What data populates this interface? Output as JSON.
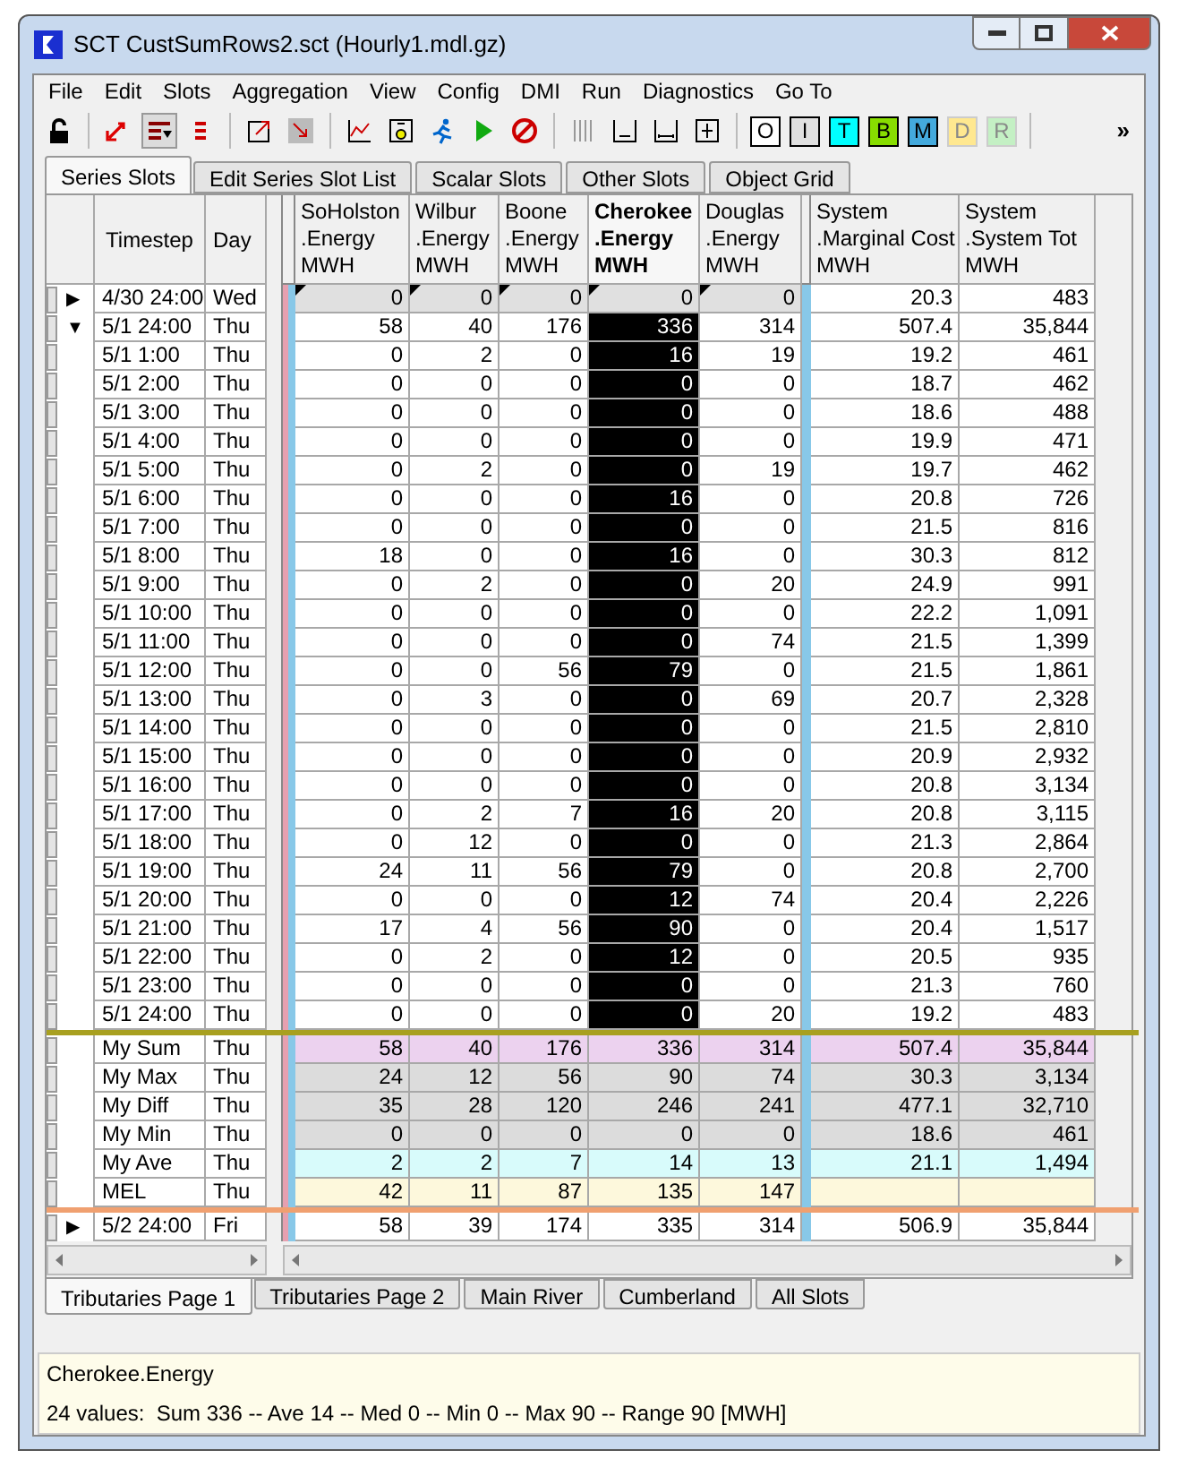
{
  "window": {
    "title": "SCT CustSumRows2.sct (Hourly1.mdl.gz)"
  },
  "menu": [
    "File",
    "Edit",
    "Slots",
    "Aggregation",
    "View",
    "Config",
    "DMI",
    "Run",
    "Diagnostics",
    "Go To"
  ],
  "toolbar": {
    "letter_buttons": [
      {
        "label": "O",
        "color": "#ffffff",
        "disabled": false
      },
      {
        "label": "I",
        "color": "#e0e0e0",
        "disabled": false
      },
      {
        "label": "T",
        "color": "#00ffff",
        "disabled": false
      },
      {
        "label": "B",
        "color": "#88dd00",
        "disabled": false
      },
      {
        "label": "M",
        "color": "#44aadd",
        "disabled": false
      },
      {
        "label": "D",
        "color": "#ffe890",
        "disabled": true
      },
      {
        "label": "R",
        "color": "#c4f0c4",
        "disabled": true
      }
    ],
    "overflow": "»"
  },
  "tabs": [
    {
      "label": "Series Slots",
      "selected": true
    },
    {
      "label": "Edit Series Slot List",
      "selected": false
    },
    {
      "label": "Scalar Slots",
      "selected": false
    },
    {
      "label": "Other Slots",
      "selected": false
    },
    {
      "label": "Object Grid",
      "selected": false
    }
  ],
  "table": {
    "row_headers": [
      "Timestep",
      "Day"
    ],
    "column_groups": [
      {
        "columns": [
          {
            "lines": [
              "SoHolston",
              ".Energy",
              "MWH"
            ],
            "selected": false
          },
          {
            "lines": [
              "Wilbur",
              ".Energy",
              "MWH"
            ],
            "selected": false
          },
          {
            "lines": [
              "Boone",
              ".Energy",
              "MWH"
            ],
            "selected": false
          },
          {
            "lines": [
              "Cherokee",
              ".Energy",
              "MWH"
            ],
            "selected": true
          },
          {
            "lines": [
              "Douglas",
              ".Energy",
              "MWH"
            ],
            "selected": false
          }
        ]
      },
      {
        "columns": [
          {
            "lines": [
              "System",
              ".Marginal Cost",
              "MWH"
            ],
            "selected": false
          },
          {
            "lines": [
              "System",
              ".System Tot",
              "MWH"
            ],
            "selected": false
          }
        ]
      }
    ],
    "rows": [
      {
        "kind": "initial",
        "marker": "▶",
        "timestep": "4/30 24:00",
        "day": "Wed",
        "values": [
          [
            "0",
            "0",
            "0",
            "0",
            "0"
          ],
          [
            "20.3",
            "483"
          ]
        ]
      },
      {
        "kind": "parent",
        "marker": "▼",
        "timestep": "5/1 24:00",
        "day": "Thu",
        "values": [
          [
            "58",
            "40",
            "176",
            "336",
            "314"
          ],
          [
            "507.4",
            "35,844"
          ]
        ]
      },
      {
        "kind": "child",
        "timestep": "5/1 1:00",
        "day": "Thu",
        "values": [
          [
            "0",
            "2",
            "0",
            "16",
            "19"
          ],
          [
            "19.2",
            "461"
          ]
        ]
      },
      {
        "kind": "child",
        "timestep": "5/1 2:00",
        "day": "Thu",
        "values": [
          [
            "0",
            "0",
            "0",
            "0",
            "0"
          ],
          [
            "18.7",
            "462"
          ]
        ]
      },
      {
        "kind": "child",
        "timestep": "5/1 3:00",
        "day": "Thu",
        "values": [
          [
            "0",
            "0",
            "0",
            "0",
            "0"
          ],
          [
            "18.6",
            "488"
          ]
        ]
      },
      {
        "kind": "child",
        "timestep": "5/1 4:00",
        "day": "Thu",
        "values": [
          [
            "0",
            "0",
            "0",
            "0",
            "0"
          ],
          [
            "19.9",
            "471"
          ]
        ]
      },
      {
        "kind": "child",
        "timestep": "5/1 5:00",
        "day": "Thu",
        "values": [
          [
            "0",
            "2",
            "0",
            "0",
            "19"
          ],
          [
            "19.7",
            "462"
          ]
        ]
      },
      {
        "kind": "child",
        "timestep": "5/1 6:00",
        "day": "Thu",
        "values": [
          [
            "0",
            "0",
            "0",
            "16",
            "0"
          ],
          [
            "20.8",
            "726"
          ]
        ]
      },
      {
        "kind": "child",
        "timestep": "5/1 7:00",
        "day": "Thu",
        "values": [
          [
            "0",
            "0",
            "0",
            "0",
            "0"
          ],
          [
            "21.5",
            "816"
          ]
        ]
      },
      {
        "kind": "child",
        "timestep": "5/1 8:00",
        "day": "Thu",
        "values": [
          [
            "18",
            "0",
            "0",
            "16",
            "0"
          ],
          [
            "30.3",
            "812"
          ]
        ]
      },
      {
        "kind": "child",
        "timestep": "5/1 9:00",
        "day": "Thu",
        "values": [
          [
            "0",
            "2",
            "0",
            "0",
            "20"
          ],
          [
            "24.9",
            "991"
          ]
        ]
      },
      {
        "kind": "child",
        "timestep": "5/1 10:00",
        "day": "Thu",
        "values": [
          [
            "0",
            "0",
            "0",
            "0",
            "0"
          ],
          [
            "22.2",
            "1,091"
          ]
        ]
      },
      {
        "kind": "child",
        "timestep": "5/1 11:00",
        "day": "Thu",
        "values": [
          [
            "0",
            "0",
            "0",
            "0",
            "74"
          ],
          [
            "21.5",
            "1,399"
          ]
        ]
      },
      {
        "kind": "child",
        "timestep": "5/1 12:00",
        "day": "Thu",
        "values": [
          [
            "0",
            "0",
            "56",
            "79",
            "0"
          ],
          [
            "21.5",
            "1,861"
          ]
        ]
      },
      {
        "kind": "child",
        "timestep": "5/1 13:00",
        "day": "Thu",
        "values": [
          [
            "0",
            "3",
            "0",
            "0",
            "69"
          ],
          [
            "20.7",
            "2,328"
          ]
        ]
      },
      {
        "kind": "child",
        "timestep": "5/1 14:00",
        "day": "Thu",
        "values": [
          [
            "0",
            "0",
            "0",
            "0",
            "0"
          ],
          [
            "21.5",
            "2,810"
          ]
        ]
      },
      {
        "kind": "child",
        "timestep": "5/1 15:00",
        "day": "Thu",
        "values": [
          [
            "0",
            "0",
            "0",
            "0",
            "0"
          ],
          [
            "20.9",
            "2,932"
          ]
        ]
      },
      {
        "kind": "child",
        "timestep": "5/1 16:00",
        "day": "Thu",
        "values": [
          [
            "0",
            "0",
            "0",
            "0",
            "0"
          ],
          [
            "20.8",
            "3,134"
          ]
        ]
      },
      {
        "kind": "child",
        "timestep": "5/1 17:00",
        "day": "Thu",
        "values": [
          [
            "0",
            "2",
            "7",
            "16",
            "20"
          ],
          [
            "20.8",
            "3,115"
          ]
        ]
      },
      {
        "kind": "child",
        "timestep": "5/1 18:00",
        "day": "Thu",
        "values": [
          [
            "0",
            "12",
            "0",
            "0",
            "0"
          ],
          [
            "21.3",
            "2,864"
          ]
        ]
      },
      {
        "kind": "child",
        "timestep": "5/1 19:00",
        "day": "Thu",
        "values": [
          [
            "24",
            "11",
            "56",
            "79",
            "0"
          ],
          [
            "20.8",
            "2,700"
          ]
        ]
      },
      {
        "kind": "child",
        "timestep": "5/1 20:00",
        "day": "Thu",
        "values": [
          [
            "0",
            "0",
            "0",
            "12",
            "74"
          ],
          [
            "20.4",
            "2,226"
          ]
        ]
      },
      {
        "kind": "child",
        "timestep": "5/1 21:00",
        "day": "Thu",
        "values": [
          [
            "17",
            "4",
            "56",
            "90",
            "0"
          ],
          [
            "20.4",
            "1,517"
          ]
        ]
      },
      {
        "kind": "child",
        "timestep": "5/1 22:00",
        "day": "Thu",
        "values": [
          [
            "0",
            "2",
            "0",
            "12",
            "0"
          ],
          [
            "20.5",
            "935"
          ]
        ]
      },
      {
        "kind": "child",
        "timestep": "5/1 23:00",
        "day": "Thu",
        "values": [
          [
            "0",
            "0",
            "0",
            "0",
            "0"
          ],
          [
            "21.3",
            "760"
          ]
        ]
      },
      {
        "kind": "child",
        "timestep": "5/1 24:00",
        "day": "Thu",
        "values": [
          [
            "0",
            "0",
            "0",
            "0",
            "20"
          ],
          [
            "19.2",
            "483"
          ]
        ]
      },
      {
        "kind": "summary",
        "color": "#ecd2ef",
        "timestep": "My Sum",
        "day": "Thu",
        "values": [
          [
            "58",
            "40",
            "176",
            "336",
            "314"
          ],
          [
            "507.4",
            "35,844"
          ]
        ]
      },
      {
        "kind": "summary",
        "color": "#dcdcdc",
        "timestep": "My Max",
        "day": "Thu",
        "values": [
          [
            "24",
            "12",
            "56",
            "90",
            "74"
          ],
          [
            "30.3",
            "3,134"
          ]
        ]
      },
      {
        "kind": "summary",
        "color": "#dcdcdc",
        "timestep": "My Diff",
        "day": "Thu",
        "values": [
          [
            "35",
            "28",
            "120",
            "246",
            "241"
          ],
          [
            "477.1",
            "32,710"
          ]
        ]
      },
      {
        "kind": "summary",
        "color": "#dcdcdc",
        "timestep": "My Min",
        "day": "Thu",
        "values": [
          [
            "0",
            "0",
            "0",
            "0",
            "0"
          ],
          [
            "18.6",
            "461"
          ]
        ]
      },
      {
        "kind": "summary",
        "color": "#d8fbfb",
        "timestep": "My Ave",
        "day": "Thu",
        "values": [
          [
            "2",
            "2",
            "7",
            "14",
            "13"
          ],
          [
            "21.1",
            "1,494"
          ]
        ]
      },
      {
        "kind": "summary",
        "color": "#fdf8dc",
        "timestep": "MEL",
        "day": "Thu",
        "values": [
          [
            "42",
            "11",
            "87",
            "135",
            "147"
          ]
        ]
      },
      {
        "kind": "next",
        "marker": "▶",
        "timestep": "5/2 24:00",
        "day": "Fri",
        "values": [
          [
            "58",
            "39",
            "174",
            "335",
            "314"
          ],
          [
            "506.9",
            "35,844"
          ]
        ]
      }
    ]
  },
  "bottom_tabs": [
    {
      "label": "Tributaries Page 1",
      "selected": true
    },
    {
      "label": "Tributaries Page 2",
      "selected": false
    },
    {
      "label": "Main River",
      "selected": false
    },
    {
      "label": "Cumberland",
      "selected": false
    },
    {
      "label": "All Slots",
      "selected": false
    }
  ],
  "status": {
    "lines": [
      "Cherokee.Energy",
      "24 values:  Sum 336 -- Ave 14 -- Med 0 -- Min 0 -- Max 90 -- Range 90 [MWH]"
    ]
  }
}
